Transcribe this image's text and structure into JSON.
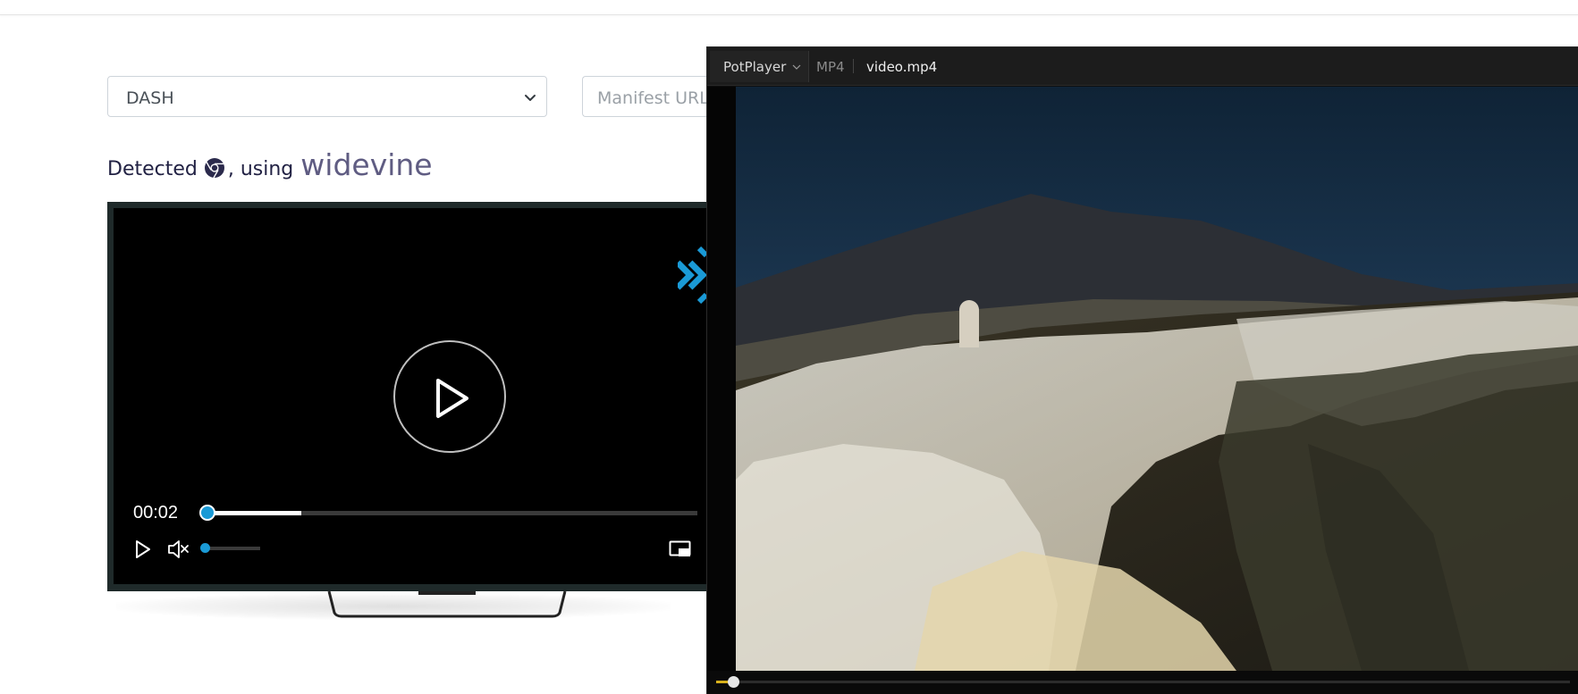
{
  "page": {
    "protocol_select": {
      "value": "DASH"
    },
    "manifest_input": {
      "placeholder": "Manifest URL"
    },
    "detection": {
      "prefix": "Detected",
      "browser_icon": "chrome-icon",
      "middle": ", using",
      "drm": "widevine"
    }
  },
  "web_player": {
    "time": "00:02",
    "progress": 0.01,
    "buffered": 0.2,
    "volume": 0.0,
    "muted": true,
    "accent": "#1a9ad6",
    "icons": [
      "play-icon",
      "mute-icon",
      "picture-in-picture-icon",
      "bitmovin-logo"
    ]
  },
  "potplayer": {
    "app_name": "PotPlayer",
    "format": "MP4",
    "filename": "video.mp4",
    "progress": 0.02,
    "accent": "#d8b11c"
  }
}
